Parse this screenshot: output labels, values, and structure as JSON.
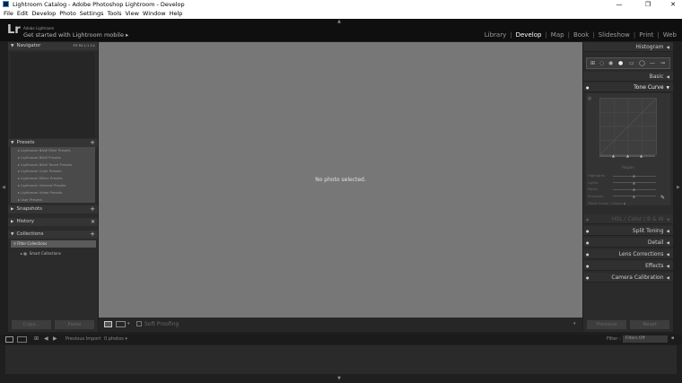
{
  "window": {
    "title": "Lightroom Catalog - Adobe Photoshop Lightroom - Develop"
  },
  "menu": [
    "File",
    "Edit",
    "Develop",
    "Photo",
    "Settings",
    "Tools",
    "View",
    "Window",
    "Help"
  ],
  "identity": {
    "logo": "Lr",
    "line1": "Adobe Lightroom",
    "line2": "Get started with Lightroom mobile ▸"
  },
  "modules": [
    "Library",
    "Develop",
    "Map",
    "Book",
    "Slideshow",
    "Print",
    "Web"
  ],
  "active_module": "Develop",
  "left_panel": {
    "navigator": {
      "title": "Navigator",
      "zoom": [
        "FIT",
        "Fill",
        "1:1",
        "1:1"
      ]
    },
    "presets": {
      "title": "Presets",
      "items": [
        "Lightroom B&W Filter Presets",
        "Lightroom B&W Presets",
        "Lightroom B&W Toned Presets",
        "Lightroom Color Presets",
        "Lightroom Effect Presets",
        "Lightroom General Presets",
        "Lightroom Video Presets",
        "User Presets"
      ]
    },
    "snapshots": {
      "title": "Snapshots"
    },
    "history": {
      "title": "History"
    },
    "collections": {
      "title": "Collections",
      "filter": "Filter Collections",
      "smart": "Smart Collections"
    },
    "copy_label": "Copy...",
    "paste_label": "Paste"
  },
  "center": {
    "message": "No photo selected.",
    "soft_proofing": "Soft Proofing"
  },
  "right_panel": {
    "histogram": "Histogram",
    "basic": "Basic",
    "tone_curve": "Tone Curve",
    "region": "Region",
    "sliders": [
      "Highlights",
      "Lights",
      "Darks",
      "Shadows"
    ],
    "point_curve_label": "Point Curve :",
    "point_curve_value": "Linear ◆",
    "hsl_row": [
      "HSL",
      "/",
      "Color",
      "/",
      "B & W"
    ],
    "split_toning": "Split Toning",
    "detail": "Detail",
    "lens_corrections": "Lens Corrections",
    "effects": "Effects",
    "camera_calibration": "Camera Calibration",
    "previous_label": "Previous",
    "reset_label": "Reset"
  },
  "filmstrip": {
    "source": "Previous Import",
    "count": "0 photos ▾",
    "filter_label": "Filter :",
    "filter_value": "Filters Off"
  }
}
